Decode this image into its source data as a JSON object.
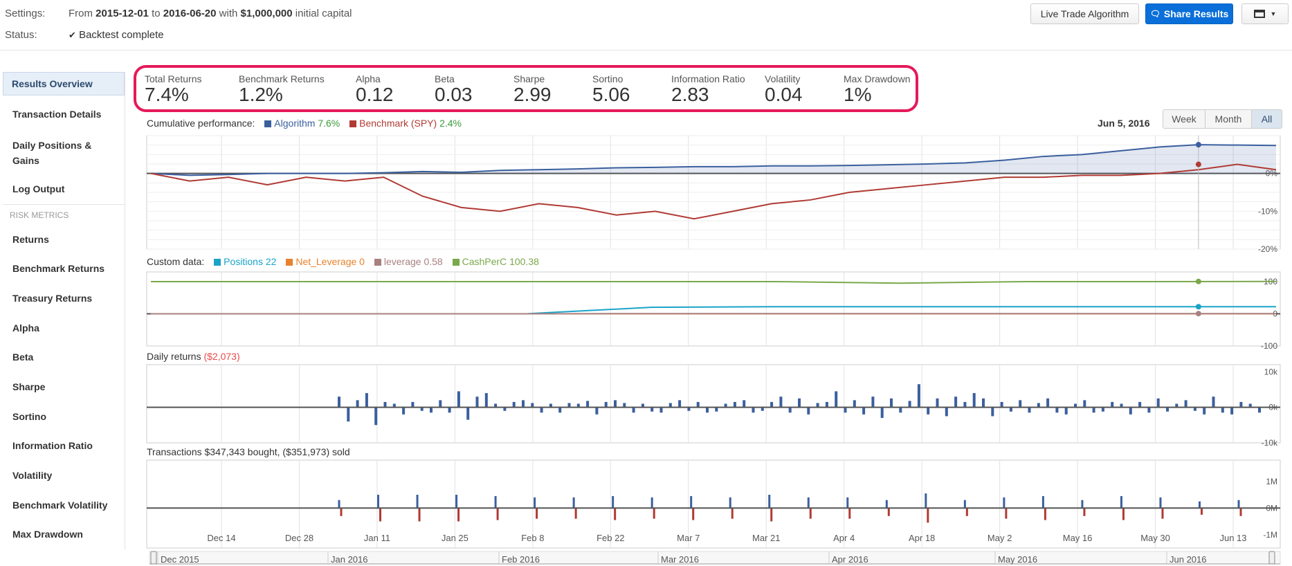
{
  "header": {
    "settings_label": "Settings:",
    "from_word": "From",
    "start_date": "2015-12-01",
    "to_word": "to",
    "end_date": "2016-06-20",
    "with_word": "with",
    "capital": "$1,000,000",
    "capital_suffix": "initial capital",
    "status_label": "Status:",
    "status_value": "Backtest complete",
    "live_button": "Live Trade Algorithm",
    "share_button": "Share Results"
  },
  "sidebar": {
    "items": [
      {
        "label": "Results Overview",
        "active": true
      },
      {
        "label": "Transaction Details"
      },
      {
        "label": "Daily Positions & Gains"
      },
      {
        "label": "Log Output"
      }
    ],
    "risk_heading": "RISK METRICS",
    "risk_items": [
      "Returns",
      "Benchmark Returns",
      "Treasury Returns",
      "Alpha",
      "Beta",
      "Sharpe",
      "Sortino",
      "Information Ratio",
      "Volatility",
      "Benchmark Volatility",
      "Max Drawdown"
    ]
  },
  "metrics": [
    {
      "label": "Total Returns",
      "value": "7.4%"
    },
    {
      "label": "Benchmark Returns",
      "value": "1.2%"
    },
    {
      "label": "Alpha",
      "value": "0.12"
    },
    {
      "label": "Beta",
      "value": "0.03"
    },
    {
      "label": "Sharpe",
      "value": "2.99"
    },
    {
      "label": "Sortino",
      "value": "5.06"
    },
    {
      "label": "Information Ratio",
      "value": "2.83"
    },
    {
      "label": "Volatility",
      "value": "0.04"
    },
    {
      "label": "Max Drawdown",
      "value": "1%"
    }
  ],
  "range_buttons": [
    {
      "label": "Week"
    },
    {
      "label": "Month"
    },
    {
      "label": "All",
      "active": true
    }
  ],
  "hover_date": "Jun 5, 2016",
  "cumulative": {
    "title": "Cumulative performance:",
    "algo_name": "Algorithm",
    "algo_value": "7.6%",
    "bench_name": "Benchmark (SPY)",
    "bench_value": "2.4%"
  },
  "custom": {
    "title": "Custom data:",
    "series": [
      {
        "name": "Positions",
        "value": "22",
        "color": "#1aa3c9"
      },
      {
        "name": "Net_Leverage",
        "value": "0",
        "color": "#e8822c"
      },
      {
        "name": "leverage",
        "value": "0.58",
        "color": "#a98080"
      },
      {
        "name": "CashPerC",
        "value": "100.38",
        "color": "#7aa84a"
      }
    ]
  },
  "daily": {
    "title": "Daily returns",
    "value": "($2,073)"
  },
  "transactions": {
    "title": "Transactions $347,343 bought, ($351,973) sold"
  },
  "colors": {
    "algo": "#3a5f9e",
    "bench": "#b03a34",
    "accent": "#0a6fd8",
    "highlight": "#e5195a"
  },
  "chart_data": [
    {
      "type": "line",
      "title": "Cumulative performance",
      "x_ticks": [
        "Dec 14",
        "Dec 28",
        "Jan 11",
        "Jan 25",
        "Feb 8",
        "Feb 22",
        "Mar 7",
        "Mar 21",
        "Apr 4",
        "Apr 18",
        "May 2",
        "May 16",
        "May 30",
        "Jun 13"
      ],
      "y_ticks": [
        "0%",
        "-10%",
        "-20%"
      ],
      "ylim": [
        -20,
        10
      ],
      "series": [
        {
          "name": "Algorithm",
          "values": [
            0,
            -0.5,
            -0.3,
            0,
            0,
            0,
            0.2,
            0.5,
            0.3,
            0.8,
            1,
            1.2,
            1.5,
            1.6,
            1.8,
            1.8,
            2,
            2,
            2.1,
            2.3,
            2.5,
            2.8,
            3.5,
            4.5,
            5,
            6,
            7,
            7.6,
            7.5,
            7.4
          ]
        },
        {
          "name": "Benchmark (SPY)",
          "values": [
            0,
            -2,
            -1,
            -3,
            -1,
            -2,
            -1,
            -6,
            -9,
            -10,
            -8,
            -9,
            -11,
            -10,
            -12,
            -10,
            -8,
            -7,
            -5,
            -4,
            -3,
            -2,
            -1,
            -1,
            -0.5,
            -0.5,
            0,
            1,
            2.4,
            1
          ]
        }
      ]
    },
    {
      "type": "line",
      "title": "Custom data",
      "y_ticks": [
        "100",
        "0",
        "-100"
      ],
      "ylim": [
        -100,
        130
      ],
      "series": [
        {
          "name": "Positions",
          "values": [
            0,
            0,
            0,
            0,
            20,
            22,
            22,
            22,
            22,
            22
          ]
        },
        {
          "name": "Net_Leverage",
          "values": [
            0,
            0,
            0,
            0,
            0,
            0,
            0,
            0,
            0,
            0
          ]
        },
        {
          "name": "leverage",
          "values": [
            0,
            0,
            0,
            0,
            0.6,
            0.6,
            0.6,
            0.6,
            0.6,
            0.58
          ]
        },
        {
          "name": "CashPerC",
          "values": [
            100,
            100,
            100,
            100,
            100,
            100,
            95,
            100,
            100,
            100.38
          ]
        }
      ]
    },
    {
      "type": "bar",
      "title": "Daily returns",
      "y_ticks": [
        "10k",
        "0k",
        "-10k"
      ],
      "ylim": [
        -10000,
        12000
      ],
      "values": [
        3000,
        -4000,
        2000,
        4000,
        -5000,
        1500,
        1000,
        -2000,
        1500,
        -1000,
        -1500,
        2000,
        -1500,
        4500,
        -3500,
        3000,
        4000,
        1000,
        -1000,
        1500,
        2000,
        1200,
        -1500,
        1000,
        -1500,
        1200,
        1000,
        1800,
        -2000,
        1500,
        2000,
        1200,
        -1500,
        1000,
        -1200,
        -1500,
        1200,
        2000,
        -1000,
        1500,
        -1500,
        -1200,
        1000,
        1500,
        2000,
        -1500,
        -1000,
        1500,
        3000,
        -1500,
        2500,
        -2000,
        1200,
        1500,
        4500,
        -1500,
        2000,
        -2000,
        3000,
        -3000,
        2500,
        -1500,
        1800,
        6500,
        -2000,
        2500,
        -2500,
        3000,
        1500,
        4000,
        2500,
        -2500,
        1500,
        -1200,
        2000,
        -1500,
        1200,
        2500,
        -1500,
        -2000,
        1000,
        2000,
        -1500,
        -1200,
        1500,
        1000,
        -2000,
        1500,
        -1500,
        2500,
        -1200,
        1000,
        2000,
        -1000,
        -2000,
        3000,
        -1500,
        -2000,
        1500,
        1000,
        -1500
      ]
    },
    {
      "type": "bar",
      "title": "Transactions",
      "y_ticks": [
        "1M",
        "0M",
        "-1M"
      ],
      "ylim": [
        -1500000,
        1800000
      ],
      "bought": [
        300000,
        500000,
        500000,
        500000,
        450000,
        400000,
        400000,
        450000,
        400000,
        450000,
        400000,
        500000,
        400000,
        400000,
        300000,
        550000,
        300000,
        400000,
        450000,
        300000,
        450000,
        400000,
        250000,
        300000
      ],
      "sold": [
        -300000,
        -500000,
        -500000,
        -500000,
        -450000,
        -400000,
        -400000,
        -450000,
        -400000,
        -450000,
        -400000,
        -500000,
        -400000,
        -400000,
        -300000,
        -550000,
        -300000,
        -400000,
        -450000,
        -300000,
        -450000,
        -400000,
        -250000,
        -300000
      ]
    }
  ],
  "navigator": {
    "labels": [
      "Dec 2015",
      "Jan 2016",
      "Feb 2016",
      "Mar 2016",
      "Apr 2016",
      "May 2016",
      "Jun 2016"
    ]
  }
}
